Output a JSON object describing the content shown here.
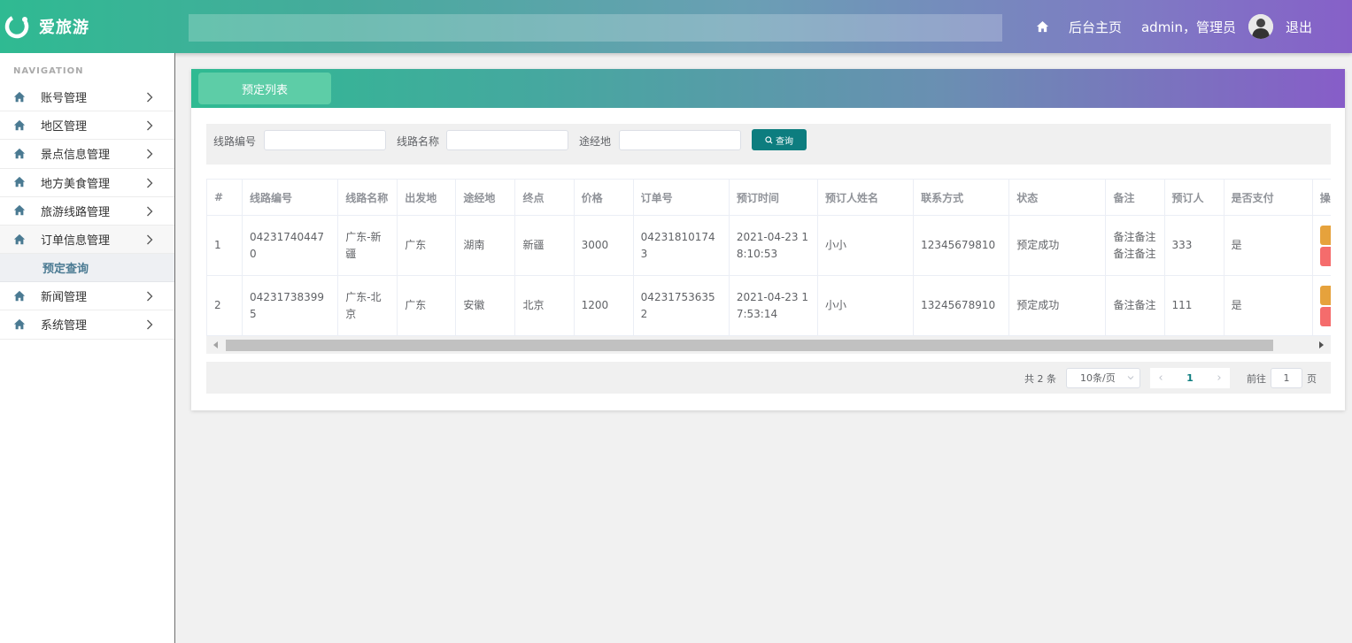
{
  "header": {
    "app_name": "爱旅游",
    "home_label": "后台主页",
    "user_label": "admin，管理员",
    "logout_label": "退出"
  },
  "sidebar": {
    "nav_title": "NAVIGATION",
    "items": [
      {
        "label": "账号管理"
      },
      {
        "label": "地区管理"
      },
      {
        "label": "景点信息管理"
      },
      {
        "label": "地方美食管理"
      },
      {
        "label": "旅游线路管理"
      },
      {
        "label": "订单信息管理"
      }
    ],
    "sub_item": "预定查询",
    "items_after": [
      {
        "label": "新闻管理"
      },
      {
        "label": "系统管理"
      }
    ]
  },
  "main": {
    "tab_label": "预定列表",
    "filters": {
      "route_no_label": "线路编号",
      "route_name_label": "线路名称",
      "via_label": "途经地",
      "query_button": "查询"
    },
    "table": {
      "columns": [
        "#",
        "线路编号",
        "线路名称",
        "出发地",
        "途经地",
        "终点",
        "价格",
        "订单号",
        "预订时间",
        "预订人姓名",
        "联系方式",
        "状态",
        "备注",
        "预订人",
        "是否支付",
        "操"
      ],
      "rows": [
        [
          "1",
          "042317404470",
          "广东-新疆",
          "广东",
          "湖南",
          "新疆",
          "3000",
          "042318101743",
          "2021-04-23 18:10:53",
          "小小",
          "12345679810",
          "预定成功",
          "备注备注备注备注",
          "333",
          "是"
        ],
        [
          "2",
          "042317383995",
          "广东-北京",
          "广东",
          "安徽",
          "北京",
          "1200",
          "042317536352",
          "2021-04-23 17:53:14",
          "小小",
          "13245678910",
          "预定成功",
          "备注备注",
          "111",
          "是"
        ]
      ]
    },
    "pagination": {
      "total": "共 2 条",
      "page_size": "10条/页",
      "current_page": "1",
      "goto_label": "前往",
      "goto_value": "1",
      "page_suffix": "页"
    }
  },
  "colors": {
    "accent": "#0d7d7f",
    "header_start": "#2fba92",
    "header_end": "#8660c8",
    "edit_button": "#e6a23c",
    "delete_button": "#f56c6c"
  }
}
